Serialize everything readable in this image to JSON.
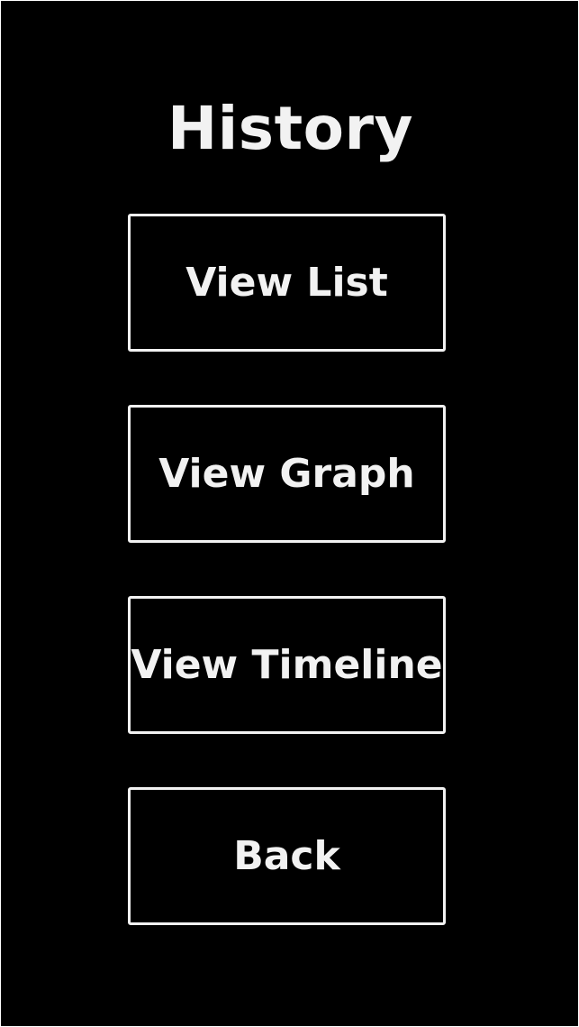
{
  "screen": {
    "title": "History",
    "background": "#000000",
    "foreground": "#f2f2f2"
  },
  "menu": {
    "view_list_label": "View List",
    "view_graph_label": "View Graph",
    "view_timeline_label": "View Timeline",
    "back_label": "Back"
  }
}
